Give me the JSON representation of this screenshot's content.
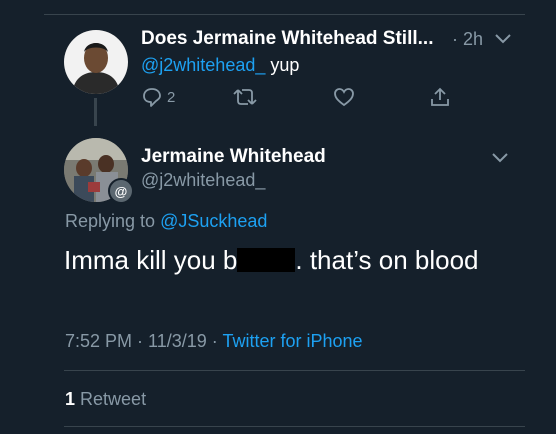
{
  "parent_tweet": {
    "name": "Does Jermaine Whitehead Still...",
    "time": "2h",
    "handle": "@j2whitehead_",
    "text": "yup",
    "reply_count": "2"
  },
  "main_tweet": {
    "name": "Jermaine Whitehead",
    "handle": "@j2whitehead_",
    "replying_prefix": "Replying to",
    "replying_to": "@JSuckhead",
    "text_before": "Imma kill you b",
    "text_after": ". that’s on blood",
    "avatar_badge": "@",
    "timestamp": "7:52 PM · 11/3/19 ·",
    "source": "Twitter for iPhone",
    "retweet_count": "1",
    "retweet_label": "Retweet"
  },
  "colors": {
    "background": "#15202b",
    "link": "#1da1f2",
    "secondary_text": "#8899a6",
    "divider": "#38444d"
  }
}
